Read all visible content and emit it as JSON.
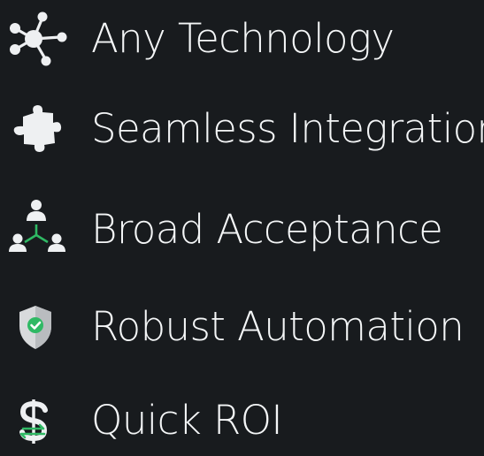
{
  "features": [
    {
      "label": "Any Technology",
      "icon": "network-nodes-icon"
    },
    {
      "label": "Seamless Integration",
      "icon": "puzzle-piece-icon"
    },
    {
      "label": "Broad Acceptance",
      "icon": "user-network-icon"
    },
    {
      "label": "Robust Automation",
      "icon": "shield-check-icon"
    },
    {
      "label": "Quick ROI",
      "icon": "dollar-exchange-icon"
    }
  ],
  "colors": {
    "background": "#181b1e",
    "text": "#f4f6f7",
    "icon": "#eef0f2",
    "accent_green": "#2fb964",
    "shield_fill": "#d8dadc"
  }
}
